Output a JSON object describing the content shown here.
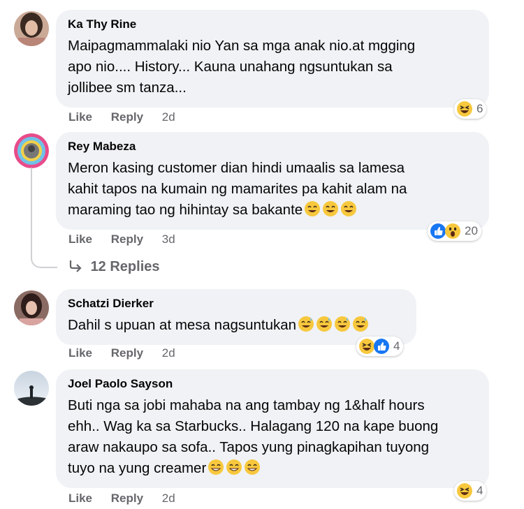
{
  "comments": [
    {
      "author": "Ka Thy Rine",
      "text": "Maipagmammalaki nio Yan sa mga anak nio.at mgging\napo nio.... History... Kauna unahang ngsuntukan sa\njollibee sm tanza...",
      "actions": {
        "like": "Like",
        "reply": "Reply",
        "time": "2d"
      },
      "reactions": {
        "icons": [
          "haha-icon"
        ],
        "count": "6"
      }
    },
    {
      "author": "Rey Mabeza",
      "text": "Meron kasing customer dian hindi umaalis sa lamesa\nkahit tapos na kumain ng mamarites pa kahit alam na\nmaraming tao ng hihintay sa bakante",
      "actions": {
        "like": "Like",
        "reply": "Reply",
        "time": "3d"
      },
      "reactions": {
        "icons": [
          "like-icon",
          "wow-icon"
        ],
        "count": "20"
      },
      "replies_label": "12 Replies"
    },
    {
      "author": "Schatzi Dierker",
      "text": "Dahil s upuan at mesa nagsuntukan",
      "actions": {
        "like": "Like",
        "reply": "Reply",
        "time": "2d"
      },
      "reactions": {
        "icons": [
          "haha-icon",
          "like-icon"
        ],
        "count": "4"
      }
    },
    {
      "author": "Joel Paolo Sayson",
      "text": "Buti nga sa jobi mahaba na ang tambay ng 1&half hours\nehh.. Wag ka sa Starbucks.. Halagang 120 na kape buong\naraw nakaupo sa sofa.. Tapos yung pinagkapihan tuyong\ntuyo na yung creamer",
      "actions": {
        "like": "Like",
        "reply": "Reply",
        "time": "2d"
      },
      "reactions": {
        "icons": [
          "haha-icon"
        ],
        "count": "4"
      }
    }
  ],
  "colors": {
    "bubble": "#f0f2f5",
    "muted": "#65676b",
    "like_blue": "#1877f2",
    "emoji_yellow": "#f7c83d"
  }
}
